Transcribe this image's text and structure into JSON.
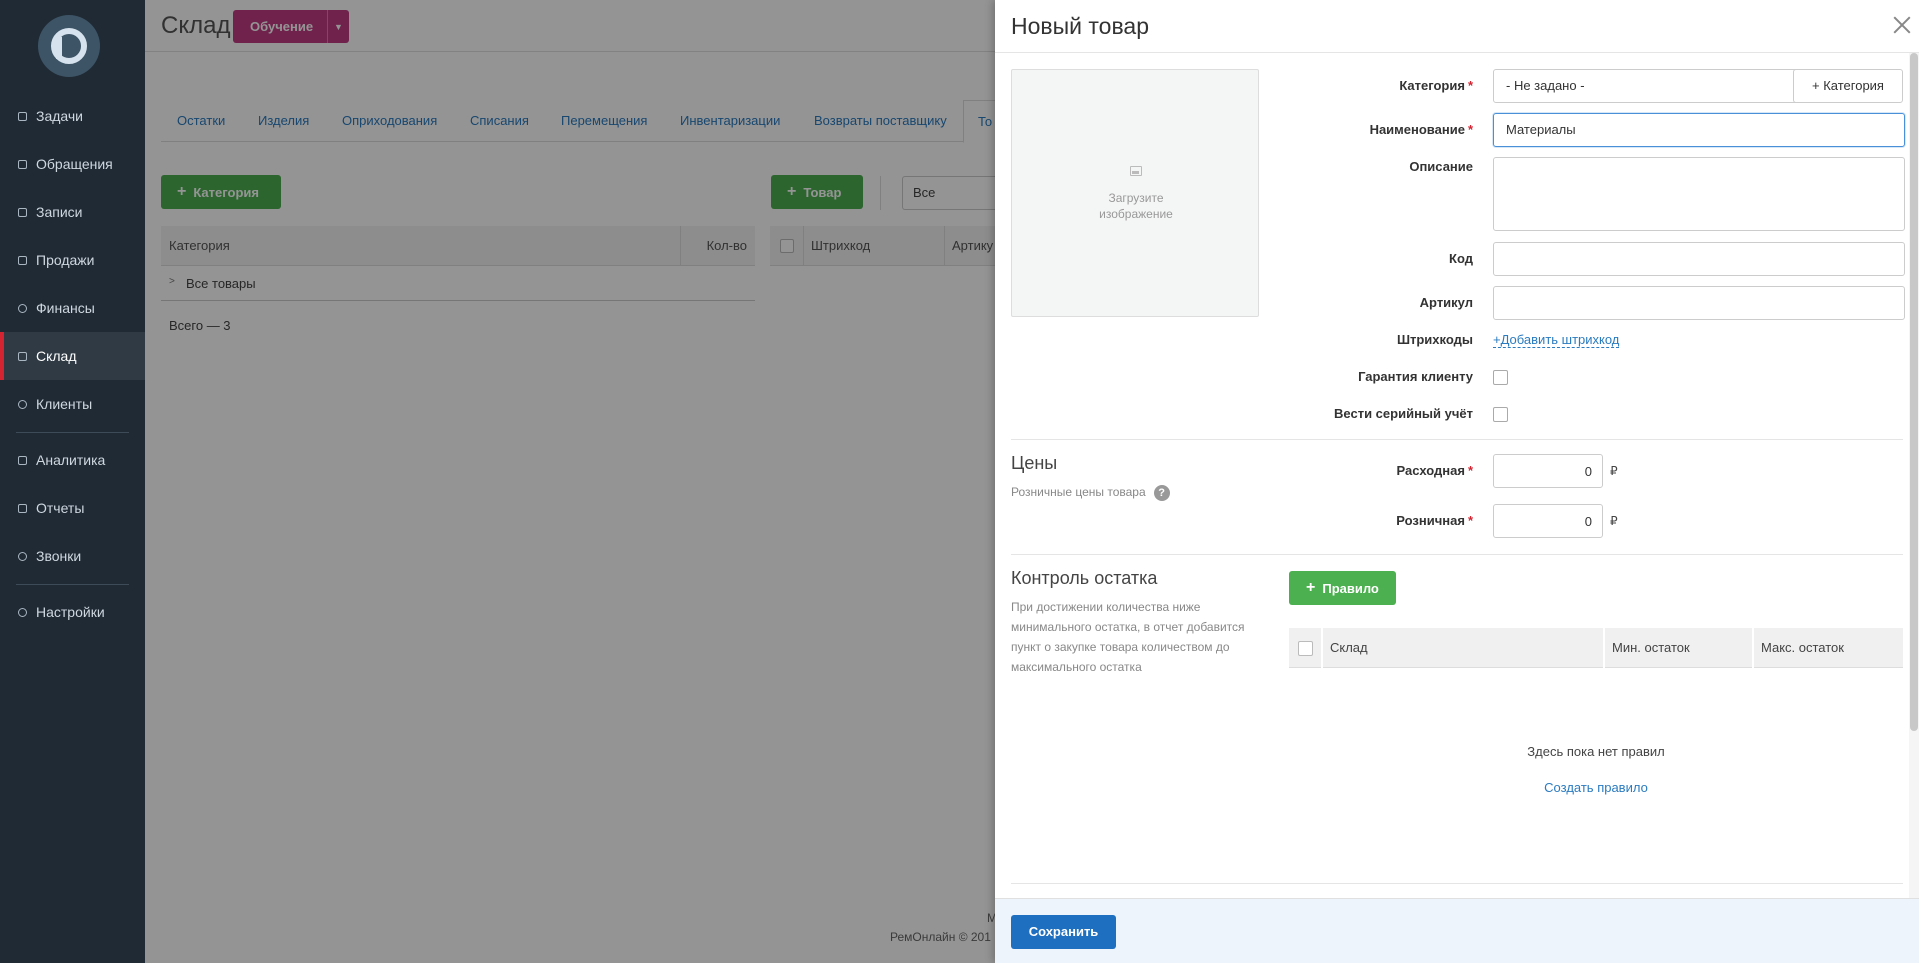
{
  "sidebar": {
    "items": [
      {
        "label": "Задачи",
        "icon": "tasks-icon"
      },
      {
        "label": "Обращения",
        "icon": "requests-icon"
      },
      {
        "label": "Записи",
        "icon": "records-icon"
      },
      {
        "label": "Продажи",
        "icon": "cart-icon"
      },
      {
        "label": "Финансы",
        "icon": "finance-icon"
      },
      {
        "label": "Склад",
        "icon": "warehouse-icon",
        "active": true
      },
      {
        "label": "Клиенты",
        "icon": "clients-icon"
      },
      {
        "label": "Аналитика",
        "icon": "analytics-icon"
      },
      {
        "label": "Отчеты",
        "icon": "reports-icon"
      },
      {
        "label": "Звонки",
        "icon": "phone-icon"
      },
      {
        "label": "Настройки",
        "icon": "gear-icon"
      }
    ]
  },
  "main": {
    "title": "Склад",
    "learn_button": "Обучение",
    "tabs": [
      "Остатки",
      "Изделия",
      "Оприходования",
      "Списания",
      "Перемещения",
      "Инвентаризации",
      "Возвраты поставщику",
      "То"
    ],
    "add_category": "Категория",
    "add_goods": "Товар",
    "filter_value": "Все",
    "cat_table": {
      "col_category": "Категория",
      "col_qty": "Кол-во",
      "row": "Все товары",
      "total": "Всего — 3"
    },
    "goods_table": {
      "col_barcode": "Штрихкод",
      "col_article": "Артику"
    },
    "footer": "РемОнлайн © 201",
    "footer_m": "М"
  },
  "panel": {
    "title": "Новый товар",
    "upload_text_1": "Загрузите",
    "upload_text_2": "изображение",
    "fields": {
      "category_label": "Категория",
      "category_value": "- Не задано -",
      "add_category_btn": "+ Категория",
      "name_label": "Наименование",
      "name_value": "Материалы",
      "description_label": "Описание",
      "code_label": "Код",
      "article_label": "Артикул",
      "barcodes_label": "Штрихкоды",
      "add_barcode": "+Добавить штрихкод",
      "warranty_label": "Гарантия клиенту",
      "serial_label": "Вести серийный учёт"
    },
    "prices": {
      "title": "Цены",
      "desc": "Розничные цены товара",
      "cost_label": "Расходная",
      "cost_value": "0",
      "retail_label": "Розничная",
      "retail_value": "0",
      "currency": "₽"
    },
    "stock": {
      "title": "Контроль остатка",
      "desc_1": "При достижении количества ниже",
      "desc_2": "минимального остатка, в отчет добавится",
      "desc_3": "пункт о закупке товара количеством до",
      "desc_4": "максимального остатка",
      "rule_btn": "Правило",
      "col_warehouse": "Склад",
      "col_min": "Мин. остаток",
      "col_max": "Макс. остаток",
      "empty": "Здесь пока нет правил",
      "create_rule": "Создать правило"
    },
    "save": "Сохранить"
  },
  "colors": {
    "sidebar_bg": "#1f2a35",
    "accent_red": "#d42331",
    "green": "#4caf50",
    "primary_blue": "#1f6fc0",
    "learn_pink": "#c23a84"
  }
}
